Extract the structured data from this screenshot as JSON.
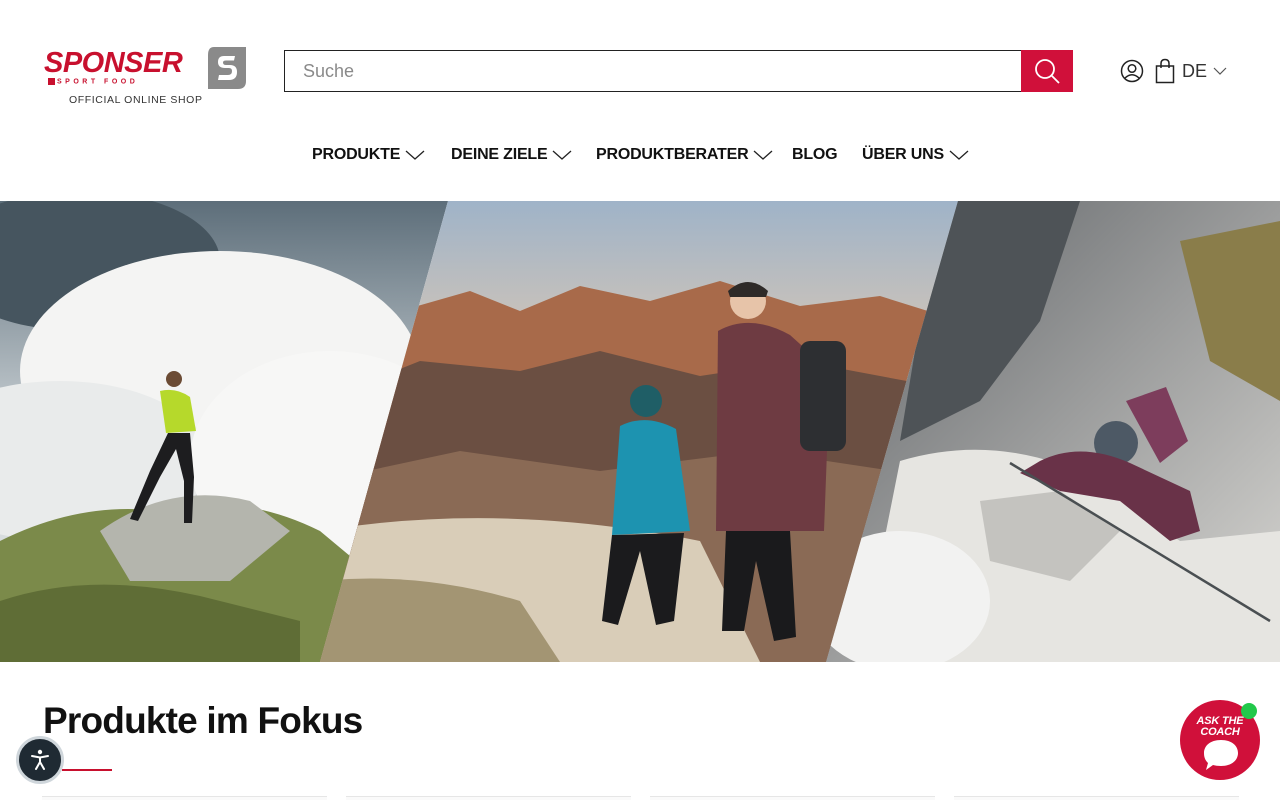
{
  "brand": {
    "name": "SPONSER",
    "subline": "SPORT FOOD",
    "tagline": "OFFICIAL ONLINE SHOP",
    "color": "#c8102e"
  },
  "search": {
    "placeholder": "Suche",
    "button_icon": "search-icon",
    "button_color": "#d0103a"
  },
  "header_actions": {
    "user_icon": "user-icon",
    "cart_icon": "shopping-bag-icon",
    "language": "DE"
  },
  "nav": {
    "items": [
      {
        "label": "PRODUKTE",
        "has_dropdown": true
      },
      {
        "label": "DEINE ZIELE",
        "has_dropdown": true
      },
      {
        "label": "PRODUKTBERATER",
        "has_dropdown": true
      },
      {
        "label": "BLOG",
        "has_dropdown": false
      },
      {
        "label": "ÜBER UNS",
        "has_dropdown": true
      }
    ]
  },
  "hero": {
    "panels": [
      "trail-runner-in-clouds",
      "hikers-on-mountain-ridge",
      "climber-on-via-ferrata"
    ]
  },
  "section": {
    "title": "Produkte im Fokus"
  },
  "widgets": {
    "accessibility_icon": "accessibility-icon",
    "coach_line1": "ASK THE",
    "coach_line2": "COACH",
    "coach_status_color": "#22c84a"
  }
}
